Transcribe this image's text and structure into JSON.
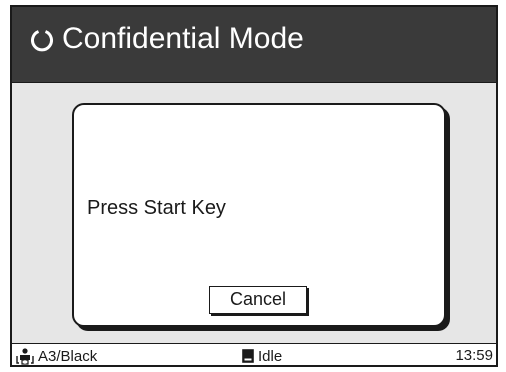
{
  "header": {
    "title": "Confidential Mode",
    "icon": "power-icon"
  },
  "dialog": {
    "message": "Press Start Key",
    "cancel_label": "Cancel"
  },
  "status_bar": {
    "paper": "A3/Black",
    "paper_icon": "copy-icon",
    "machine_status": "Idle",
    "machine_status_icon": "idle-icon",
    "time": "13:59"
  }
}
